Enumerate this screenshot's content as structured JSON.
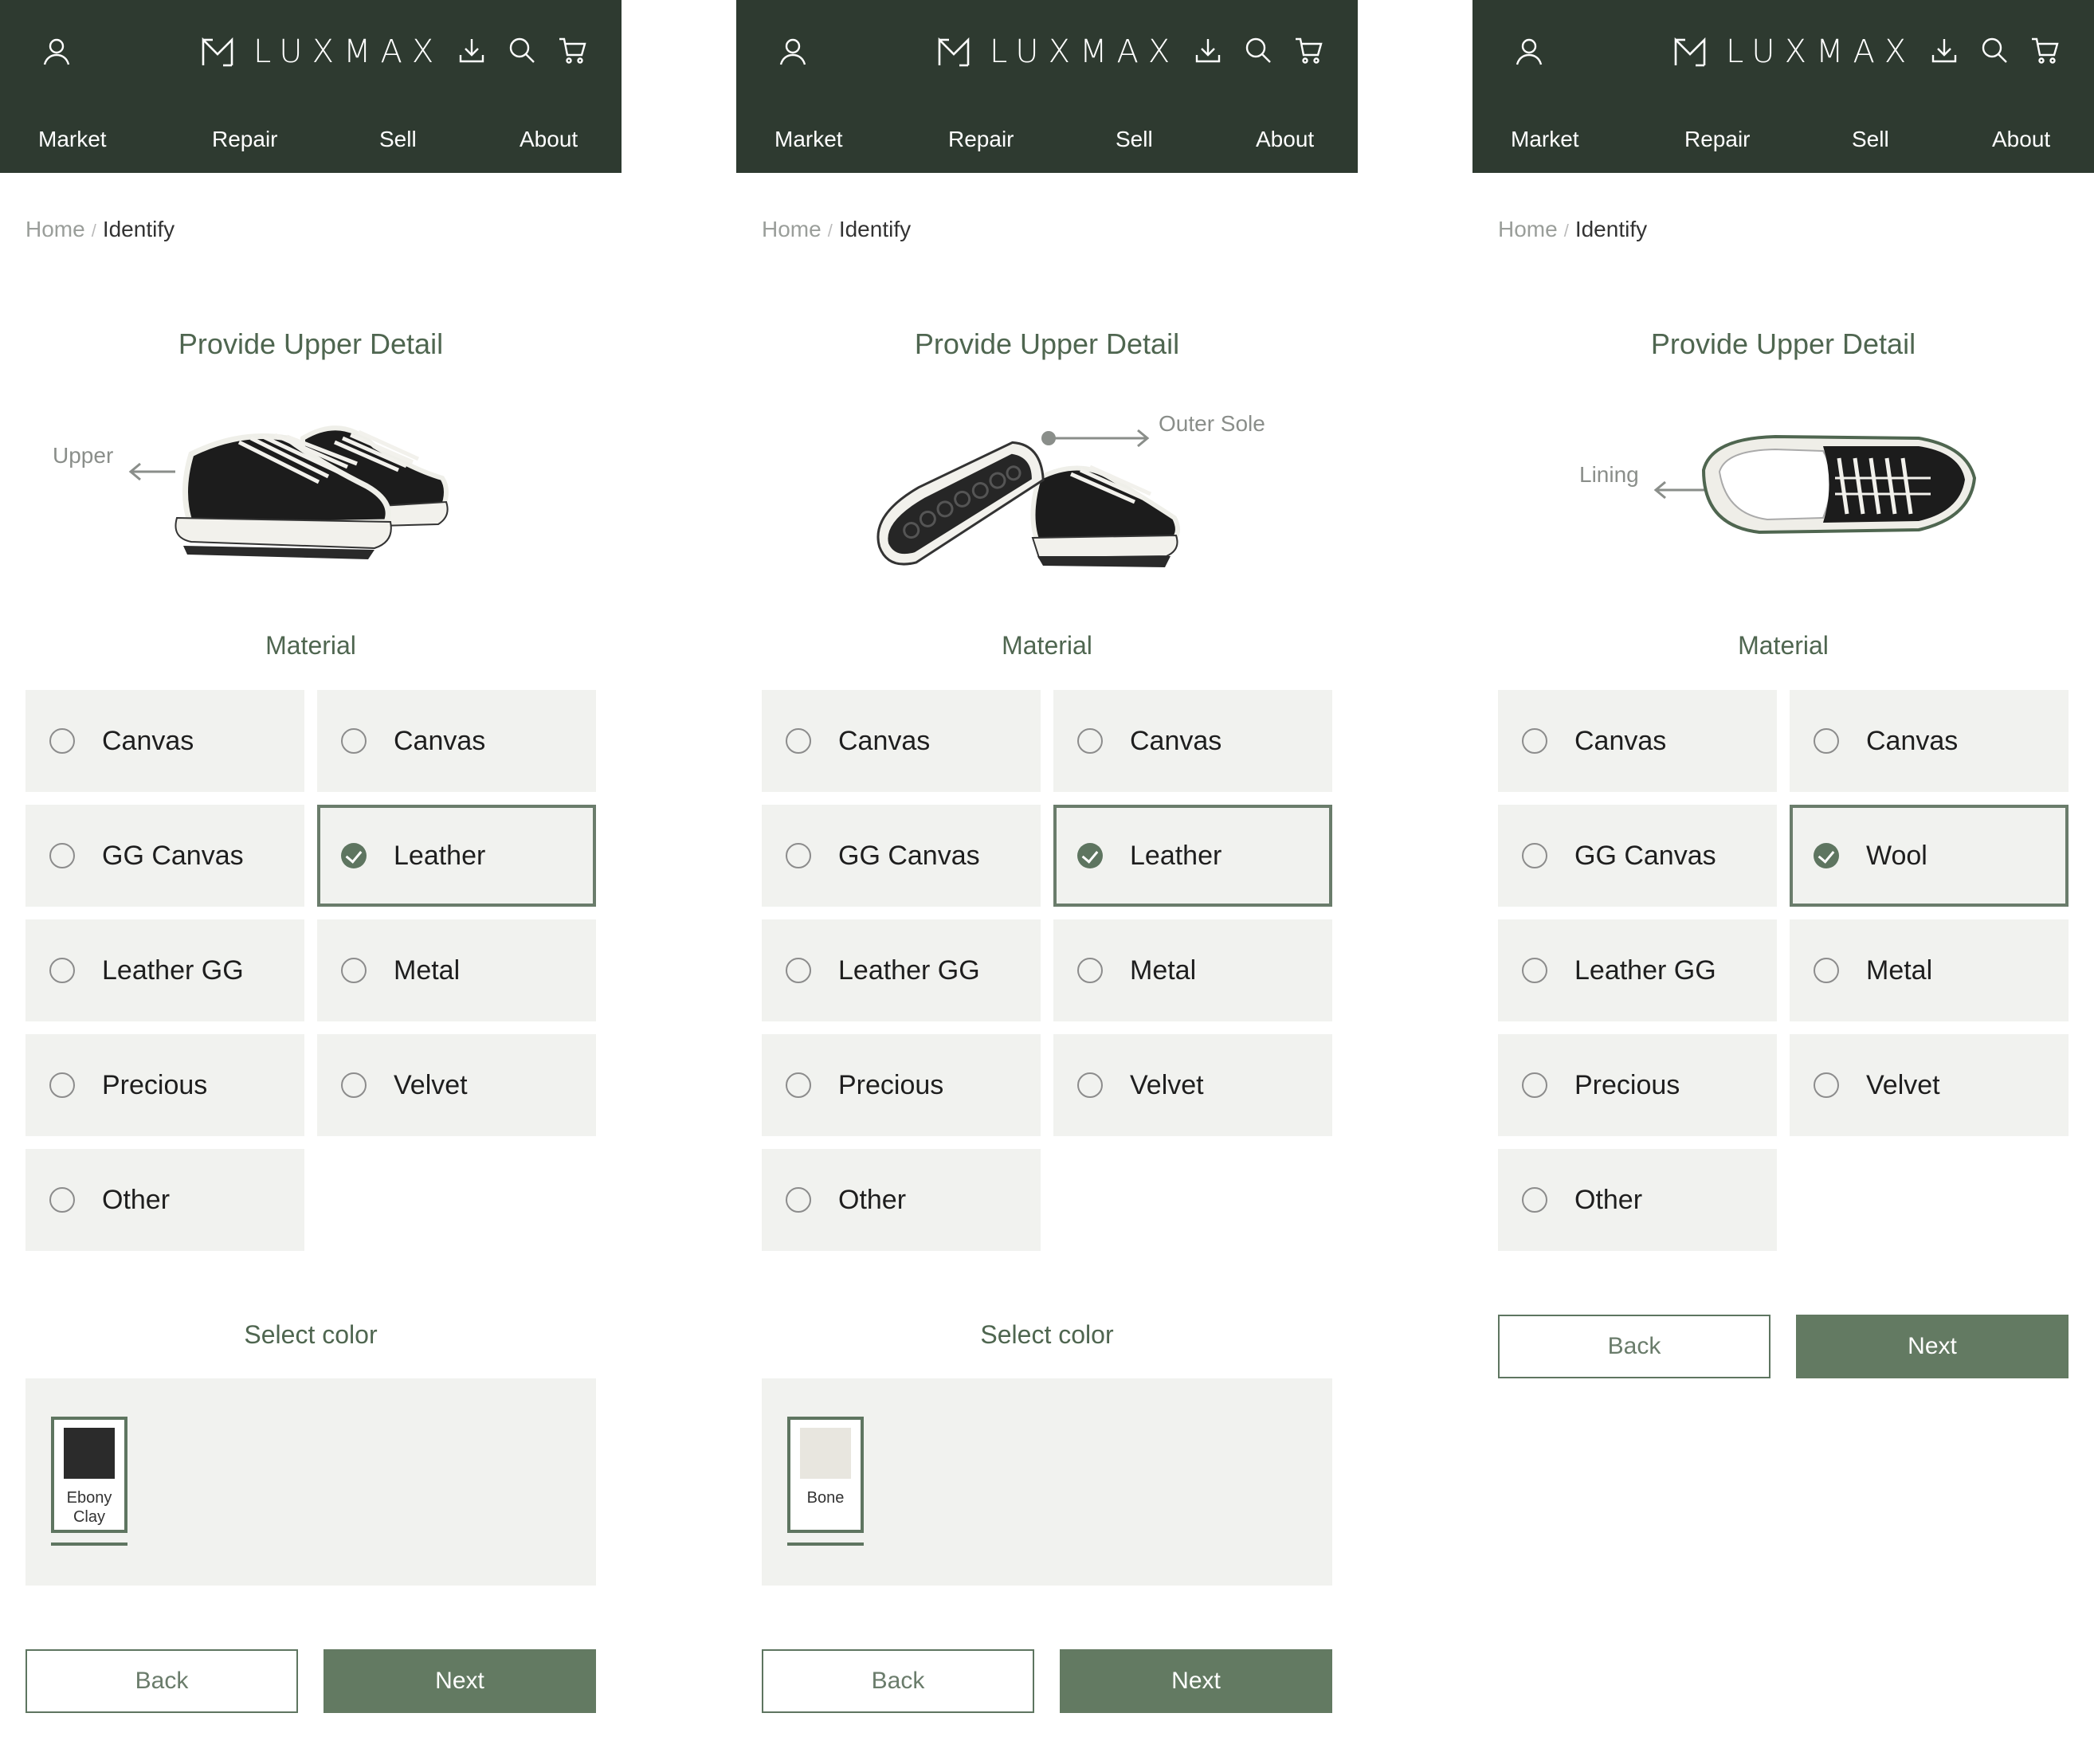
{
  "brand": {
    "name": "LUXMAX"
  },
  "nav": [
    "Market",
    "Repair",
    "Sell",
    "About"
  ],
  "breadcrumb": {
    "home": "Home",
    "separator": "/",
    "current": "Identify"
  },
  "colors": {
    "header_bg": "#2e3a30",
    "accent": "#5e7560",
    "button": "#637a62",
    "option_bg": "#f1f2ef",
    "title": "#4f6650"
  },
  "icons": {
    "user": "user-icon",
    "logo": "luxmax-logo-icon",
    "download": "download-icon",
    "search": "search-icon",
    "cart": "cart-icon",
    "radio_checked": "check-icon"
  },
  "screens": [
    {
      "title": "Provide Upper Detail",
      "callout": "Upper",
      "material_title": "Material",
      "materials": [
        "Canvas",
        "Canvas",
        "GG Canvas",
        "Leather",
        "Leather GG",
        "Metal",
        "Precious",
        "Velvet",
        "Other"
      ],
      "selected_material": "Leather",
      "color_title": "Select color",
      "swatch": {
        "line1": "Ebony",
        "line2": "Clay",
        "hex": "#2b2b2b"
      },
      "back": "Back",
      "next": "Next"
    },
    {
      "title": "Provide Upper Detail",
      "callout": "Outer Sole",
      "material_title": "Material",
      "materials": [
        "Canvas",
        "Canvas",
        "GG Canvas",
        "Leather",
        "Leather GG",
        "Metal",
        "Precious",
        "Velvet",
        "Other"
      ],
      "selected_material": "Leather",
      "color_title": "Select color",
      "swatch": {
        "line1": "Bone",
        "line2": "",
        "hex": "#e8e6df"
      },
      "back": "Back",
      "next": "Next"
    },
    {
      "title": "Provide Upper Detail",
      "callout": "Lining",
      "material_title": "Material",
      "materials": [
        "Canvas",
        "Canvas",
        "GG Canvas",
        "Wool",
        "Leather GG",
        "Metal",
        "Precious",
        "Velvet",
        "Other"
      ],
      "selected_material": "Wool",
      "back": "Back",
      "next": "Next"
    }
  ]
}
